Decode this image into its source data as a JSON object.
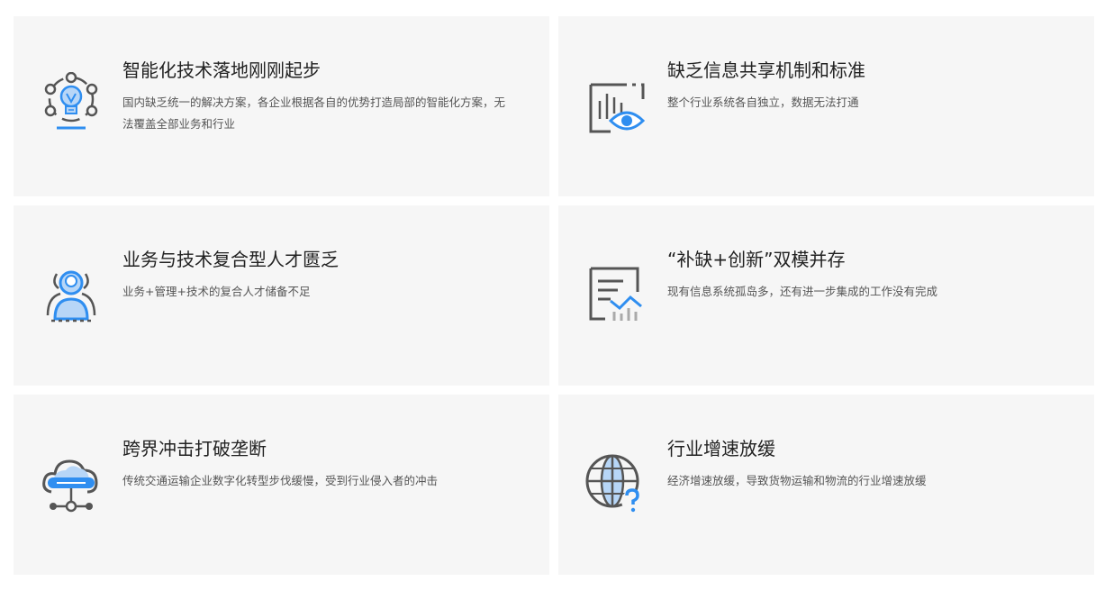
{
  "cards": [
    {
      "icon": "lightbulb-network-icon",
      "title": "智能化技术落地刚刚起步",
      "desc": "国内缺乏统一的解决方案，各企业根据各自的优势打造局部的智能化方案，无法覆盖全部业务和行业"
    },
    {
      "icon": "chart-eye-icon",
      "title": "缺乏信息共享机制和标准",
      "desc": "整个行业系统各自独立，数据无法打通"
    },
    {
      "icon": "user-profile-icon",
      "title": "业务与技术复合型人才匮乏",
      "desc": "业务+管理+技术的复合人才储备不足"
    },
    {
      "icon": "report-chart-icon",
      "title": "“补缺+创新”双模并存",
      "desc": "现有信息系统孤岛多，还有进一步集成的工作没有完成"
    },
    {
      "icon": "cloud-network-icon",
      "title": "跨界冲击打破垄断",
      "desc": "传统交通运输企业数字化转型步伐缓慢，受到行业侵入者的冲击"
    },
    {
      "icon": "globe-question-icon",
      "title": "行业增速放缓",
      "desc": "经济增速放缓，导致货物运输和物流的行业增速放缓"
    }
  ],
  "colors": {
    "card_bg": "#f6f6f6",
    "icon_dark": "#555555",
    "icon_blue": "#2f8ef0",
    "icon_light_blue": "#b7d6f7"
  }
}
